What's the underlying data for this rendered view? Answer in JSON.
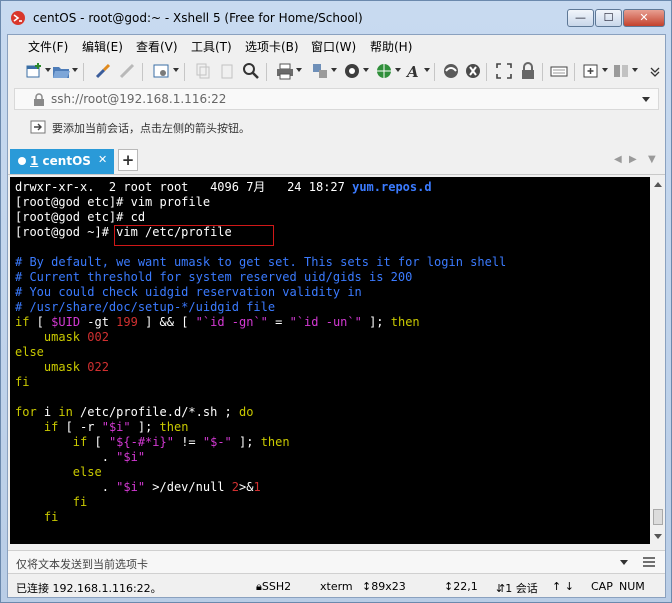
{
  "window": {
    "title": "centOS - root@god:~ - Xshell 5 (Free for Home/School)",
    "controls": {
      "minimize": "—",
      "maximize": "☐",
      "close": "✕"
    }
  },
  "menu": [
    "文件(F)",
    "编辑(E)",
    "查看(V)",
    "工具(T)",
    "选项卡(B)",
    "窗口(W)",
    "帮助(H)"
  ],
  "address": {
    "value": "ssh://root@192.168.1.116:22"
  },
  "hint": {
    "text": "要添加当前会话，点击左侧的箭头按钮。"
  },
  "tab": {
    "number": "1",
    "name": "centOS",
    "close": "✕",
    "add": "+"
  },
  "terminal": {
    "lines": [
      "drwxr-xr-x.  2 root root   4096 7月   24 18:27 yum.repos.d",
      "[root@god etc]# vim profile",
      "[root@god etc]# cd",
      "[root@god ~]# vim /etc/profile",
      "",
      "# By default, we want umask to get set. This sets it for login shell",
      "# Current threshold for system reserved uid/gids is 200",
      "# You could check uidgid reservation validity in",
      "# /usr/share/doc/setup-*/uidgid file",
      "if [ $UID -gt 199 ] && [ \"`id -gn`\" = \"`id -un`\" ]; then",
      "    umask 002",
      "else",
      "    umask 022",
      "fi",
      "",
      "for i in /etc/profile.d/*.sh ; do",
      "    if [ -r \"$i\" ]; then",
      "        if [ \"${-#*i}\" != \"$-\" ]; then",
      "            . \"$i\"",
      "        else",
      "            . \"$i\" >/dev/null 2>&1",
      "        fi",
      "    fi"
    ],
    "ls_prefix": "drwxr-xr-x.  2 root root   4096 7月   24 18:27 ",
    "ls_dirname": "yum.repos.d"
  },
  "send_bar": {
    "text": "仅将文本发送到当前选项卡"
  },
  "status": {
    "connection": "已连接 192.168.1.116:22。",
    "protocol": "SSH2",
    "terminal_type": "xterm",
    "size": "89x23",
    "cursor": "22,1",
    "sessions": "1 会话",
    "caps": "CAP",
    "num": "NUM"
  },
  "colors": {
    "comment": "#3b7bff",
    "keyword": "#c9c900",
    "variable": "#d339d3",
    "number": "#d03030",
    "tab_active": "#2a9ad8",
    "highlight_box": "#d01818"
  }
}
